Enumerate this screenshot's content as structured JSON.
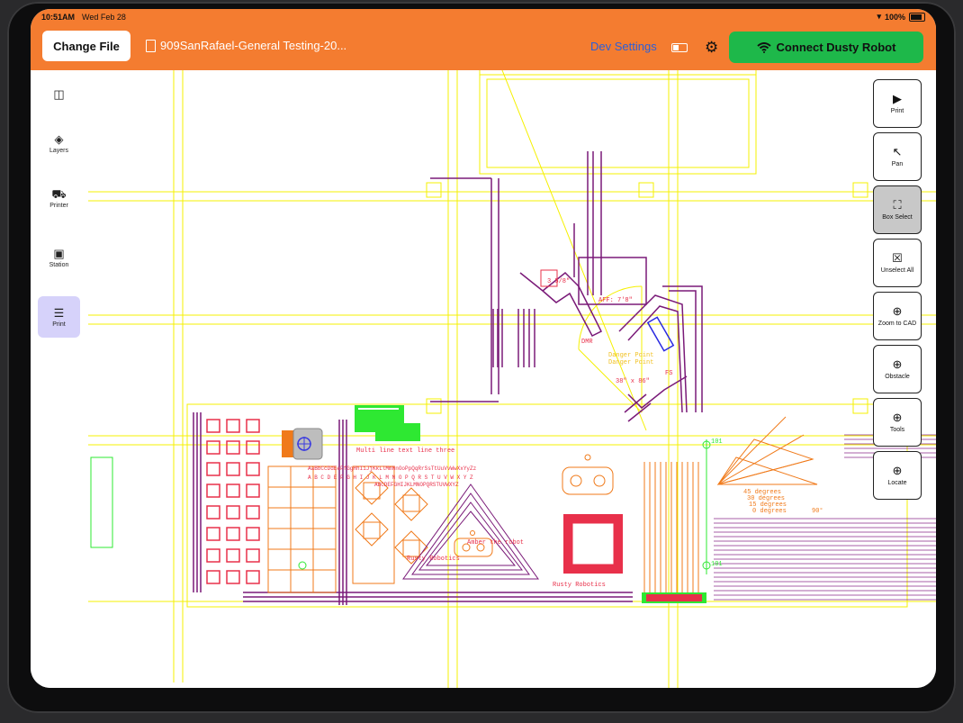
{
  "status": {
    "time": "10:51AM",
    "date": "Wed Feb 28",
    "battery": "100%"
  },
  "header": {
    "change_file": "Change File",
    "file_name": "909SanRafael-General Testing-20...",
    "dev_settings": "Dev Settings",
    "connect": "Connect Dusty Robot"
  },
  "sidebar": {
    "items": [
      {
        "label": "",
        "icon": "sidebar-toggle-icon"
      },
      {
        "label": "Layers",
        "icon": "layers-icon"
      },
      {
        "label": "Printer",
        "icon": "printer-icon"
      },
      {
        "label": "Station",
        "icon": "station-icon"
      },
      {
        "label": "Print",
        "icon": "print-list-icon"
      }
    ]
  },
  "tools": [
    {
      "label": "Print",
      "icon": "play-icon"
    },
    {
      "label": "Pan",
      "icon": "arrow-pointer-icon"
    },
    {
      "label": "Box Select",
      "icon": "box-select-icon"
    },
    {
      "label": "Unselect All",
      "icon": "unselect-icon"
    },
    {
      "label": "Zoom to CAD",
      "icon": "zoom-icon"
    },
    {
      "label": "Obstacle",
      "icon": "zoom-icon"
    },
    {
      "label": "Tools",
      "icon": "zoom-icon"
    },
    {
      "label": "Locate",
      "icon": "zoom-icon"
    }
  ],
  "cad": {
    "texts": {
      "t1": "3 5/8\"",
      "t2": "AFF: 7'8\"",
      "t3": "38\" x 86\"",
      "t4": "Multi line text line three",
      "t5": "AaBbCcDdEeFfGgHhIiJjKkLlMmNnOoPpQqRrSsTtUuVvWwXxYyZz",
      "t6": "A B C D E F G H I J K L M N O P Q R S T U V W X Y Z",
      "t7": "ABCDEFGHIJKLMNOPQRSTUVWXYZ",
      "t8": "Rusty Robotics",
      "t9": "Rusty Robotics",
      "t10": "Amber the robot",
      "t11": "45 degrees",
      "t12": "30 degrees",
      "t13": "15 degrees",
      "t14": "0 degrees",
      "t15": "90°",
      "t16": "101",
      "t17": "101",
      "t18": "FS",
      "t19": "DMR",
      "t20": "Danger Point",
      "t21": "Danger Point"
    }
  },
  "colors": {
    "accent": "#f47c30",
    "connect": "#1eb84a",
    "active_side": "#d6d2fa",
    "cad_yellow": "#f5f000",
    "cad_purple": "#7a1a78",
    "cad_red": "#e8304a",
    "cad_orange": "#f07a1a"
  }
}
